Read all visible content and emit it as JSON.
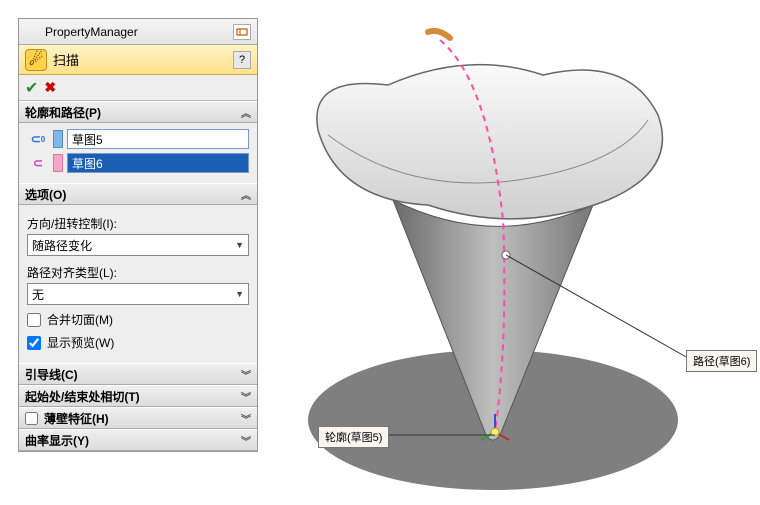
{
  "pm": {
    "title": "PropertyManager"
  },
  "feature": {
    "name": "扫描"
  },
  "groups": {
    "profile_path": {
      "title": "轮廓和路径(P)",
      "profile": "草图5",
      "path": "草图6"
    },
    "options": {
      "title": "选项(O)",
      "twist_label": "方向/扭转控制(I):",
      "twist_value": "随路径变化",
      "align_label": "路径对齐类型(L):",
      "align_value": "无",
      "merge_label": "合并切面(M)",
      "preview_label": "显示预览(W)"
    },
    "guide": {
      "title": "引导线(C)"
    },
    "startend": {
      "title": "起始处/结束处相切(T)"
    },
    "thin": {
      "title": "薄壁特征(H)"
    },
    "curvature": {
      "title": "曲率显示(Y)"
    }
  },
  "callouts": {
    "path": "路径(草图6)",
    "profile": "轮廓(草图5)"
  }
}
